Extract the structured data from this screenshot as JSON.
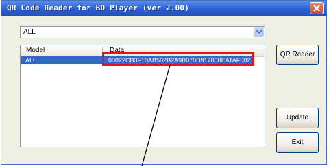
{
  "window": {
    "title": "QR Code Reader for BD Player (ver 2.00)"
  },
  "filter": {
    "selected": "ALL"
  },
  "list": {
    "columns": [
      "Model",
      "Data"
    ],
    "rows": [
      {
        "model": "ALL",
        "data": "00022CB3F10AB502B2A9B070D912000EATAF502"
      }
    ]
  },
  "buttons": {
    "qr_reader": "QR Reader",
    "update": "Update",
    "exit": "Exit"
  },
  "colors": {
    "selection": "#316ac5",
    "highlight": "#e0151b",
    "titlebar": "#2b5fd4"
  }
}
